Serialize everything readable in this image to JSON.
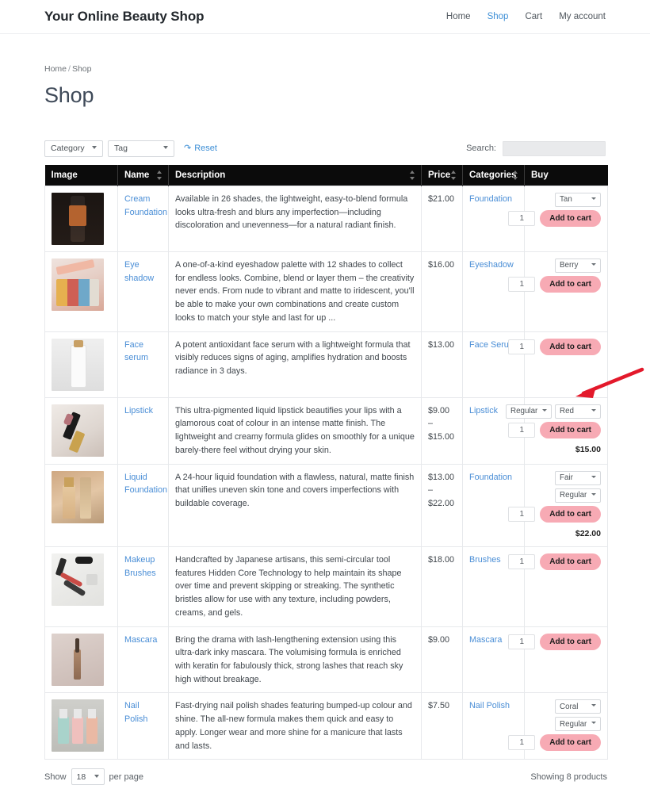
{
  "header": {
    "site_title": "Your Online Beauty Shop",
    "nav": [
      {
        "label": "Home",
        "active": false
      },
      {
        "label": "Shop",
        "active": true
      },
      {
        "label": "Cart",
        "active": false
      },
      {
        "label": "My account",
        "active": false
      }
    ]
  },
  "breadcrumb": {
    "home": "Home",
    "separator": "/",
    "current": "Shop"
  },
  "page_title": "Shop",
  "filters": {
    "category_label": "Category",
    "tag_label": "Tag",
    "reset_label": "Reset",
    "reset_icon": "undo-arrow-icon",
    "search_label": "Search:",
    "search_value": "",
    "search_placeholder": ""
  },
  "table": {
    "columns": [
      {
        "label": "Image",
        "sortable": false
      },
      {
        "label": "Name",
        "sortable": true
      },
      {
        "label": "Description",
        "sortable": true
      },
      {
        "label": "Price",
        "sortable": true
      },
      {
        "label": "Categories",
        "sortable": true
      },
      {
        "label": "Buy",
        "sortable": false
      }
    ],
    "rows": [
      {
        "name": "Cream Foundation",
        "description": "Available in 26 shades, the lightweight, easy-to-blend formula looks ultra-fresh and blurs any imperfection—including discoloration and unevenness—for a natural radiant finish.",
        "price": "$21.00",
        "category": "Foundation",
        "variations": [
          "Tan"
        ],
        "quantity": "1",
        "add_to_cart_label": "Add to cart",
        "variation_price": ""
      },
      {
        "name": "Eye shadow",
        "description": "A one-of-a-kind eyeshadow palette with 12 shades to collect for endless looks. Combine, blend or layer them – the creativity never ends. From nude to vibrant and matte to iridescent, you'll be able to make your own combinations and create custom looks to match your style and last for up ...",
        "price": "$16.00",
        "category": "Eyeshadow",
        "variations": [
          "Berry"
        ],
        "quantity": "1",
        "add_to_cart_label": "Add to cart",
        "variation_price": ""
      },
      {
        "name": "Face serum",
        "description": "A potent antioxidant face serum with a lightweight formula that visibly reduces signs of aging, amplifies hydration and boosts radiance in 3 days.",
        "price": "$13.00",
        "category": "Face Serum",
        "variations": [],
        "quantity": "1",
        "add_to_cart_label": "Add to cart",
        "variation_price": ""
      },
      {
        "name": "Lipstick",
        "description": "This ultra-pigmented liquid lipstick beautifies your lips with a glamorous coat of colour in an intense matte finish. The lightweight and creamy formula glides on smoothly for a unique barely-there feel without drying your skin.",
        "price": "$9.00 – $15.00",
        "category": "Lipstick",
        "variations": [
          "Regular",
          "Red"
        ],
        "variations_inline": true,
        "quantity": "1",
        "add_to_cart_label": "Add to cart",
        "variation_price": "$15.00"
      },
      {
        "name": "Liquid Foundation",
        "description": "A 24-hour liquid foundation with a flawless, natural, matte finish that unifies uneven skin tone and covers imperfections with buildable coverage.",
        "price": "$13.00 – $22.00",
        "category": "Foundation",
        "variations": [
          "Fair",
          "Regular"
        ],
        "quantity": "1",
        "add_to_cart_label": "Add to cart",
        "variation_price": "$22.00"
      },
      {
        "name": "Makeup Brushes",
        "description": "Handcrafted by Japanese artisans, this semi-circular tool features Hidden Core Technology to help maintain its shape over time and prevent skipping or streaking. The synthetic bristles allow for use with any texture, including powders, creams, and gels.",
        "price": "$18.00",
        "category": "Brushes",
        "variations": [],
        "quantity": "1",
        "add_to_cart_label": "Add to cart",
        "variation_price": ""
      },
      {
        "name": "Mascara",
        "description": "Bring the drama with lash-lengthening extension using this ultra-dark inky mascara. The volumising formula is enriched with keratin for fabulously thick, strong lashes that reach sky high without breakage.",
        "price": "$9.00",
        "category": "Mascara",
        "variations": [],
        "quantity": "1",
        "add_to_cart_label": "Add to cart",
        "variation_price": ""
      },
      {
        "name": "Nail Polish",
        "description": "Fast-drying nail polish shades featuring bumped-up colour and shine. The all-new formula makes them quick and easy to apply. Longer wear and more shine for a manicure that lasts and lasts.",
        "price": "$7.50",
        "category": "Nail Polish",
        "variations": [
          "Coral",
          "Regular"
        ],
        "quantity": "1",
        "add_to_cart_label": "Add to cart",
        "variation_price": ""
      }
    ]
  },
  "footer": {
    "show_label": "Show",
    "per_page_value": "18",
    "per_page_label": "per page",
    "showing_text": "Showing 8 products"
  },
  "annotation": {
    "arrow_color": "#e3192b",
    "points_to": "lipstick-variation-selects"
  },
  "colors": {
    "link": "#4a8ed6",
    "add_to_cart_bg": "#f7aab4",
    "header_bg": "#0b0b0b",
    "buy_header_text": "#f6d9a6"
  }
}
